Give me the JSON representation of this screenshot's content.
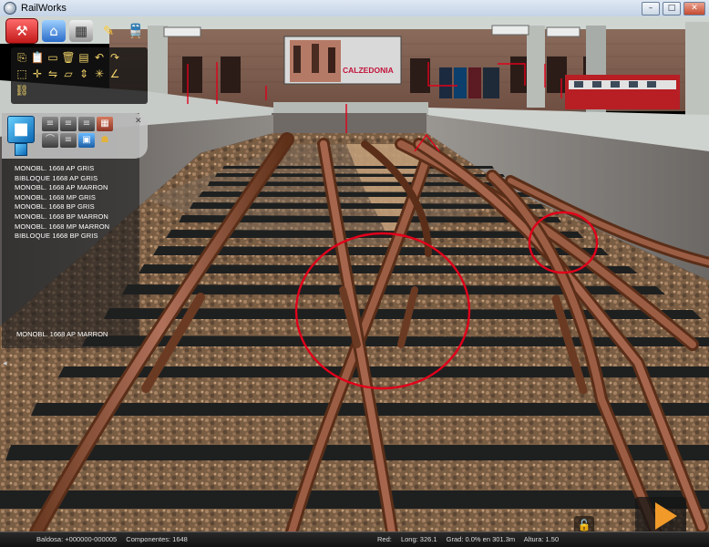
{
  "window": {
    "title": "RailWorks",
    "buttons": [
      "–",
      "□",
      "✕"
    ]
  },
  "toolbar": {
    "icons": [
      "toolbox-icon",
      "home-icon",
      "grid-icon",
      "paint-brush-icon",
      "train-icon"
    ]
  },
  "tool_panel": {
    "icons": [
      "copy-icon",
      "paste-icon",
      "monitor-icon",
      "trash-icon",
      "page-icon",
      "undo-icon",
      "redo-icon",
      "select-box-icon",
      "move-icon",
      "flip-icon",
      "layer-icon",
      "height-icon",
      "snap-icon",
      "angle-icon",
      "link-icon"
    ]
  },
  "object_browser": {
    "categories": [
      "rail",
      "rail",
      "rail",
      "rail",
      "brick",
      "rail",
      "rail",
      "blue",
      "gold"
    ],
    "items": [
      "MONOBL. 1668 AP GRIS",
      "BIBLOQUE 1668 AP GRIS",
      "MONOBL. 1668 AP MARRON",
      "MONOBL. 1668 MP GRIS",
      "MONOBL. 1668 BP GRIS",
      "MONOBL. 1668 BP MARRON",
      "MONOBL. 1668 MP MARRON",
      "BIBLOQUE 1668 BP GRIS"
    ],
    "selected": "MONOBL. 1668 AP MARRON"
  },
  "billboard": {
    "text": "CALZEDONIA"
  },
  "status": {
    "baldosa": "Baldosa: +000000-000005",
    "componentes": "Componentes: 1648",
    "red": "Red:",
    "long": "Long: 326.1",
    "grad": "Grad: 0.0% en 301.3m",
    "altura": "Altura: 1.50"
  },
  "colors": {
    "accent_red": "#e1001a",
    "play_orange": "#f19a2a"
  }
}
